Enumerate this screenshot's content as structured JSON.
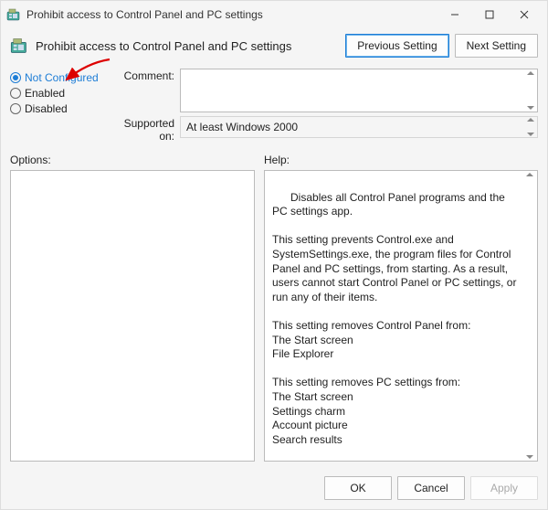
{
  "window": {
    "title": "Prohibit access to Control Panel and PC settings"
  },
  "header": {
    "policy_title": "Prohibit access to Control Panel and PC settings",
    "prev_button": "Previous Setting",
    "next_button": "Next Setting"
  },
  "radios": {
    "not_configured": "Not Configured",
    "enabled": "Enabled",
    "disabled": "Disabled",
    "selected": "not_configured"
  },
  "comment": {
    "label": "Comment:",
    "value": ""
  },
  "supported": {
    "label": "Supported on:",
    "value": "At least Windows 2000"
  },
  "panels": {
    "options_label": "Options:",
    "help_label": "Help:"
  },
  "help_text": "Disables all Control Panel programs and the PC settings app.\n\nThis setting prevents Control.exe and SystemSettings.exe, the program files for Control Panel and PC settings, from starting. As a result, users cannot start Control Panel or PC settings, or run any of their items.\n\nThis setting removes Control Panel from:\nThe Start screen\nFile Explorer\n\nThis setting removes PC settings from:\nThe Start screen\nSettings charm\nAccount picture\nSearch results\n\nIf users try to select a Control Panel item from the Properties item on a context menu, a message appears explaining that a setting prevents the action.",
  "footer": {
    "ok": "OK",
    "cancel": "Cancel",
    "apply": "Apply"
  }
}
